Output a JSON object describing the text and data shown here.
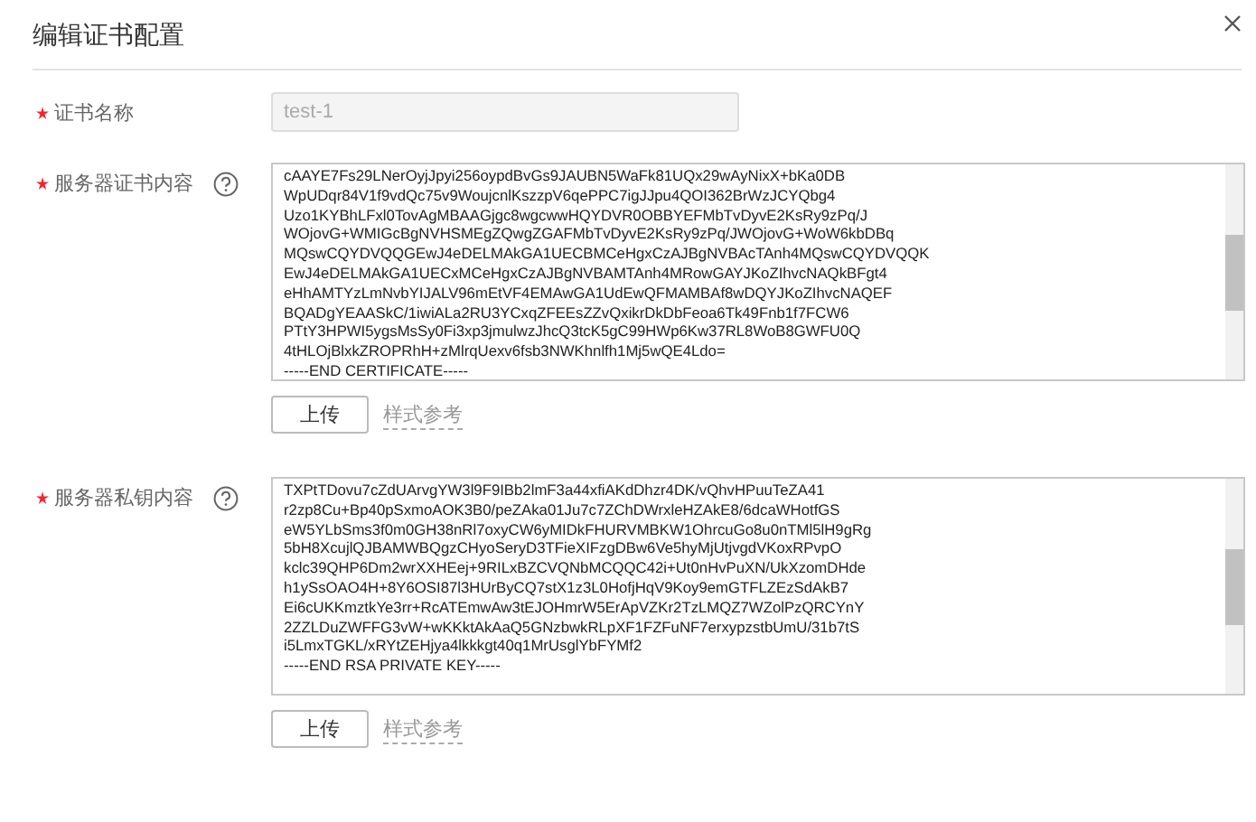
{
  "dialog": {
    "title": "编辑证书配置"
  },
  "fields": [
    {
      "kind": "input",
      "label": "证书名称",
      "required": true,
      "value": "test-1",
      "disabled": true
    },
    {
      "kind": "textarea",
      "label": "服务器证书内容",
      "required": true,
      "help": true,
      "lines": [
        "cAAYE7Fs29LNerOyjJpyi256oypdBvGs9JAUBN5WaFk81UQx29wAyNixX+bKa0DB",
        "WpUDqr84V1f9vdQc75v9WoujcnlKszzpV6qePPC7igJJpu4QOI362BrWzJCYQbg4",
        "Uzo1KYBhLFxl0TovAgMBAAGjgc8wgcwwHQYDVR0OBBYEFMbTvDyvE2KsRy9zPq/J",
        "WOjovG+WMIGcBgNVHSMEgZQwgZGAFMbTvDyvE2KsRy9zPq/JWOjovG+WoW6kbDBq",
        "MQswCQYDVQQGEwJ4eDELMAkGA1UECBMCeHgxCzAJBgNVBAcTAnh4MQswCQYDVQQK",
        "EwJ4eDELMAkGA1UECxMCeHgxCzAJBgNVBAMTAnh4MRowGAYJKoZIhvcNAQkBFgt4",
        "eHhAMTYzLmNvbYIJALV96mEtVF4EMAwGA1UdEwQFMAMBAf8wDQYJKoZIhvcNAQEF",
        "BQADgYEAASkC/1iwiALa2RU3YCxqZFEEsZZvQxikrDkDbFeoa6Tk49Fnb1f7FCW6",
        "PTtY3HPWI5ygsMsSy0Fi3xp3jmulwzJhcQ3tcK5gC99HWp6Kw37RL8WoB8GWFU0Q",
        "4tHLOjBlxkZROPRhH+zMlrqUexv6fsb3NWKhnlfh1Mj5wQE4Ldo=",
        "-----END CERTIFICATE-----"
      ],
      "upload": "上传",
      "example": "样式参考"
    },
    {
      "kind": "textarea",
      "label": "服务器私钥内容",
      "required": true,
      "help": true,
      "lines": [
        "TXPtTDovu7cZdUArvgYW3l9F9IBb2lmF3a44xfiAKdDhzr4DK/vQhvHPuuTeZA41",
        "r2zp8Cu+Bp40pSxmoAOK3B0/peZAka01Ju7c7ZChDWrxleHZAkE8/6dcaWHotfGS",
        "eW5YLbSms3f0m0GH38nRl7oxyCW6yMIDkFHURVMBKW1OhrcuGo8u0nTMl5lH9gRg",
        "5bH8XcujlQJBAMWBQgzCHyoSeryD3TFieXIFzgDBw6Ve5hyMjUtjvgdVKoxRPvpO",
        "kclc39QHP6Dm2wrXXHEej+9RILxBZCVQNbMCQQC42i+Ut0nHvPuXN/UkXzomDHde",
        "h1ySsOAO4H+8Y6OSI87l3HUrByCQ7stX1z3L0HofjHqV9Koy9emGTFLZEzSdAkB7",
        "Ei6cUKKmztkYe3rr+RcATEmwAw3tEJOHmrW5ErApVZKr2TzLMQZ7WZolPzQRCYnY",
        "2ZZLDuZWFFG3vW+wKKktAkAaQ5GNzbwkRLpXF1FZFuNF7erxypzstbUmU/31b7tS",
        "i5LmxTGKL/xRYtZEHjya4lkkkgt40q1MrUsglYbFYMf2",
        "-----END RSA PRIVATE KEY-----"
      ],
      "upload": "上传",
      "example": "样式参考"
    }
  ]
}
